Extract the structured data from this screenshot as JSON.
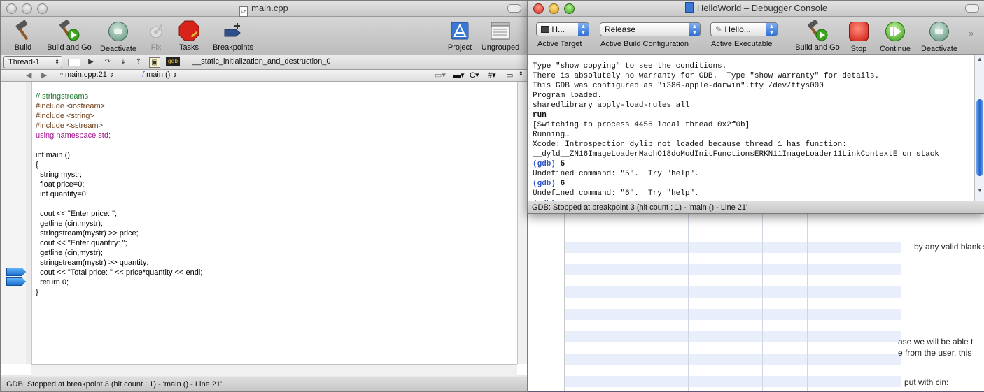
{
  "background_doc": {
    "text_1": "by any valid blank s",
    "text_2": "ase we will be able t",
    "text_3": "e from the user, this",
    "text_4": "put with cin:"
  },
  "editor": {
    "title": "main.cpp",
    "toolbar": {
      "build": "Build",
      "build_and_go": "Build and Go",
      "deactivate": "Deactivate",
      "fix": "Fix",
      "tasks": "Tasks",
      "breakpoints": "Breakpoints",
      "project": "Project",
      "ungrouped": "Ungrouped"
    },
    "thread_popup": "Thread-1",
    "stack_frame": "__static_initialization_and_destruction_0",
    "nav": {
      "file_location": "main.cpp:21",
      "function": "main ()",
      "lang": "C",
      "hash": "#"
    },
    "code_lines": [
      "// stringstreams",
      "#include <iostream>",
      "#include <string>",
      "#include <sstream>",
      "using namespace std;",
      "",
      "int main ()",
      "{",
      "  string mystr;",
      "  float price=0;",
      "  int quantity=0;",
      "",
      "  cout << \"Enter price: \";",
      "  getline (cin,mystr);",
      "  stringstream(mystr) >> price;",
      "  cout << \"Enter quantity: \";",
      "  getline (cin,mystr);",
      "  stringstream(mystr) >> quantity;",
      "  cout << \"Total price: \" << price*quantity << endl;",
      "  return 0;",
      "}"
    ],
    "status": "GDB: Stopped at breakpoint 3 (hit count : 1) - 'main () - Line 21'"
  },
  "debugger": {
    "title": "HelloWorld – Debugger Console",
    "active_target_value": "H...",
    "active_target_label": "Active Target",
    "build_config_value": "Release",
    "build_config_label": "Active Build Configuration",
    "executable_value": "Hello...",
    "executable_label": "Active Executable",
    "toolbar": {
      "build_and_go": "Build and Go",
      "stop": "Stop",
      "continue": "Continue",
      "deactivate": "Deactivate"
    },
    "console": {
      "l1": "Type \"show copying\" to see the conditions.",
      "l2": "There is absolutely no warranty for GDB.  Type \"show warranty\" for details.",
      "l3": "This GDB was configured as \"i386-apple-darwin\".tty /dev/ttys000",
      "l4": "Program loaded.",
      "l5": "sharedlibrary apply-load-rules all",
      "l6": "run",
      "l7": "[Switching to process 4456 local thread 0x2f0b]",
      "l8": "Running…",
      "l9": "Xcode: Introspection dylib not loaded because thread 1 has function:",
      "l10": "__dyld__ZN16ImageLoaderMachO18doModInitFunctionsERKN11ImageLoader11LinkContextE on stack",
      "prompt": "(gdb)",
      "cmd1": "5",
      "l12": "Undefined command: \"5\".  Try \"help\".",
      "cmd2": "6",
      "l14": "Undefined command: \"6\".  Try \"help\"."
    },
    "status": "GDB: Stopped at breakpoint 3 (hit count : 1) - 'main () - Line 21'"
  }
}
